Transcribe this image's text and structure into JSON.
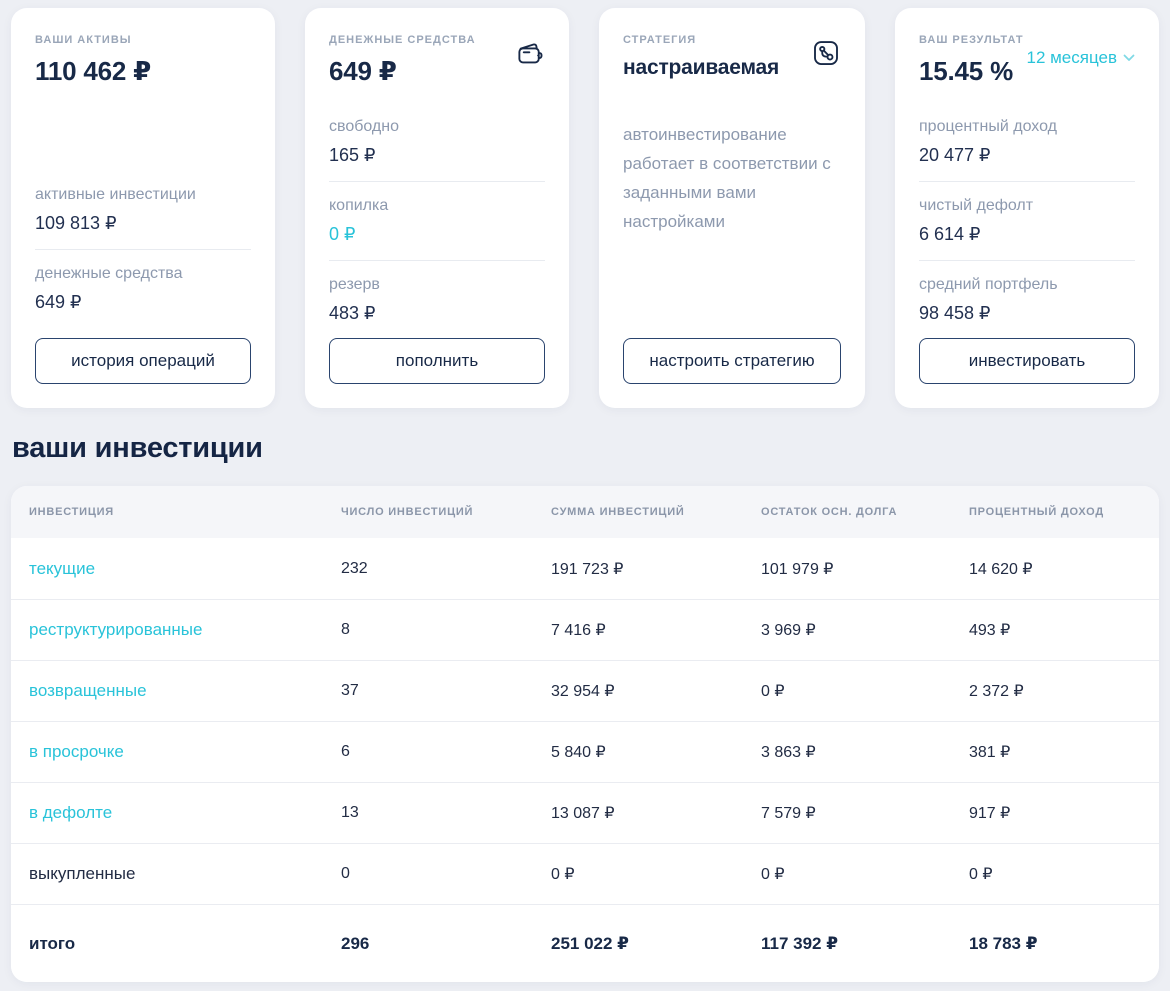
{
  "colors": {
    "accent_teal": "#29c3d9",
    "navy": "#182947",
    "page_background": "#edeff4",
    "muted_label": "#8d99ae"
  },
  "cards": {
    "assets": {
      "label": "ВАШИ АКТИВЫ",
      "value": "110 462 ₽",
      "rows": [
        {
          "label": "активные инвестиции",
          "value": "109 813 ₽"
        },
        {
          "label": "денежные средства",
          "value": "649 ₽"
        }
      ],
      "button": "история операций"
    },
    "cash": {
      "label": "ДЕНЕЖНЫЕ СРЕДСТВА",
      "value": "649 ₽",
      "icon": "wallet-icon",
      "rows": [
        {
          "label": "свободно",
          "value": "165 ₽"
        },
        {
          "label": "копилка",
          "value": "0 ₽"
        },
        {
          "label": "резерв",
          "value": "483 ₽"
        }
      ],
      "button": "пополнить"
    },
    "strategy": {
      "label": "СТРАТЕГИЯ",
      "value": "настраиваемая",
      "icon": "strategy-icon",
      "description": "автоинвестирование работает в соответствии с заданными вами настройками",
      "button": "настроить стратегию"
    },
    "result": {
      "label": "ВАШ РЕЗУЛЬТАТ",
      "value": "15.45 %",
      "period": "12 месяцев",
      "period_icon": "chevron-down-icon",
      "rows": [
        {
          "label": "процентный доход",
          "value": "20 477 ₽"
        },
        {
          "label": "чистый дефолт",
          "value": "6 614 ₽"
        },
        {
          "label": "средний портфель",
          "value": "98 458 ₽"
        }
      ],
      "button": "инвестировать"
    }
  },
  "section_title": "ваши инвестиции",
  "table": {
    "headers": [
      "ИНВЕСТИЦИЯ",
      "ЧИСЛО ИНВЕСТИЦИЙ",
      "СУММА ИНВЕСТИЦИЙ",
      "ОСТАТОК ОСН. ДОЛГА",
      "ПРОЦЕНТНЫЙ ДОХОД"
    ],
    "rows": [
      {
        "name": "текущие",
        "count": "232",
        "sum": "191 723 ₽",
        "principal": "101 979 ₽",
        "income": "14 620 ₽"
      },
      {
        "name": "реструктурированные",
        "count": "8",
        "sum": "7 416 ₽",
        "principal": "3 969 ₽",
        "income": "493 ₽"
      },
      {
        "name": "возвращенные",
        "count": "37",
        "sum": "32 954 ₽",
        "principal": "0 ₽",
        "income": "2 372 ₽"
      },
      {
        "name": "в просрочке",
        "count": "6",
        "sum": "5 840 ₽",
        "principal": "3 863 ₽",
        "income": "381 ₽"
      },
      {
        "name": "в дефолте",
        "count": "13",
        "sum": "13 087 ₽",
        "principal": "7 579 ₽",
        "income": "917 ₽"
      },
      {
        "name": "выкупленные",
        "count": "0",
        "sum": "0 ₽",
        "principal": "0 ₽",
        "income": "0 ₽"
      }
    ],
    "total": {
      "name": "итого",
      "count": "296",
      "sum": "251 022 ₽",
      "principal": "117 392 ₽",
      "income": "18 783 ₽"
    }
  }
}
